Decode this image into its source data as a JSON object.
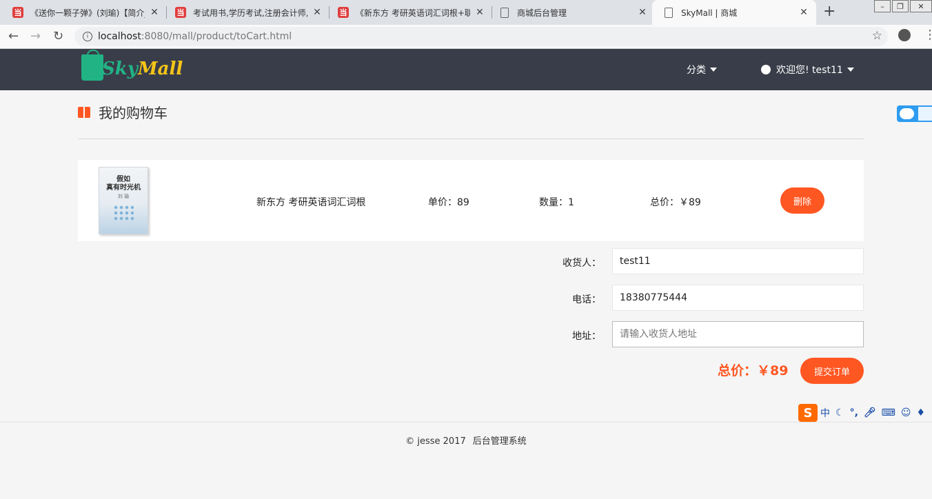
{
  "browser": {
    "tabs": [
      {
        "title": "《送你一颗子弹》(刘瑜)【简介_",
        "favicon": "dd"
      },
      {
        "title": "考试用书,学历考试,注册会计师,",
        "favicon": "dd"
      },
      {
        "title": "《新东方 考研英语词汇词根+联",
        "favicon": "dd"
      },
      {
        "title": "商城后台管理",
        "favicon": "doc"
      },
      {
        "title": "SkyMall | 商城",
        "favicon": "doc",
        "active": true
      }
    ],
    "url_host": "localhost",
    "url_path": ":8080/mall/product/toCart.html"
  },
  "header": {
    "logo_sky": "Sky",
    "logo_mall": "Mall",
    "category_label": "分类",
    "welcome_label": "欢迎您! test11"
  },
  "page": {
    "title": "我的购物车"
  },
  "cart": {
    "item": {
      "book_cover_title_1": "假如",
      "book_cover_title_2": "真有时光机",
      "book_cover_author": "刘 瑜",
      "name": "新东方 考研英语词汇词根",
      "unit_price": "单价：89",
      "quantity": "数量：1",
      "subtotal": "总价：￥89",
      "delete_label": "删除"
    }
  },
  "form": {
    "receiver_label": "收货人：",
    "receiver_value": "test11",
    "phone_label": "电话：",
    "phone_value": "18380775444",
    "address_label": "地址：",
    "address_placeholder": "请输入收货人地址"
  },
  "order": {
    "total": "总价：￥89",
    "submit_label": "提交订单"
  },
  "footer": {
    "copyright": "© jesse 2017",
    "admin_link": "后台管理系统"
  },
  "ime": {
    "logo": "S",
    "mode": "中"
  },
  "colors": {
    "accent": "#ff5722",
    "header_bg": "#393d49",
    "logo_green": "#21b384",
    "logo_yellow": "#f5c518"
  }
}
